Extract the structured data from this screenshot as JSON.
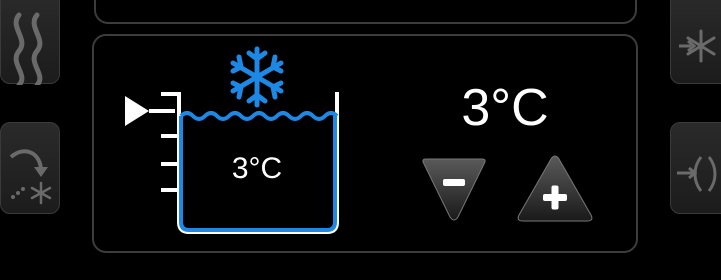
{
  "tank": {
    "temperature": "3°C"
  },
  "setpoint": {
    "temperature": "3°C"
  },
  "icons": {
    "mode": "snowflake-icon",
    "level_marker": "play-arrow-icon",
    "decrease": "minus-icon",
    "increase": "plus-icon",
    "left_top": "heat-waves-icon",
    "left_bottom": "freeze-arrow-icon",
    "right_top": "snowflake-arrow-icon",
    "right_bottom": "arrow-in-icon"
  },
  "colors": {
    "accent_blue": "#1e88e5",
    "top_accent_red": "#c62828",
    "panel_border": "#3c3c3c"
  }
}
